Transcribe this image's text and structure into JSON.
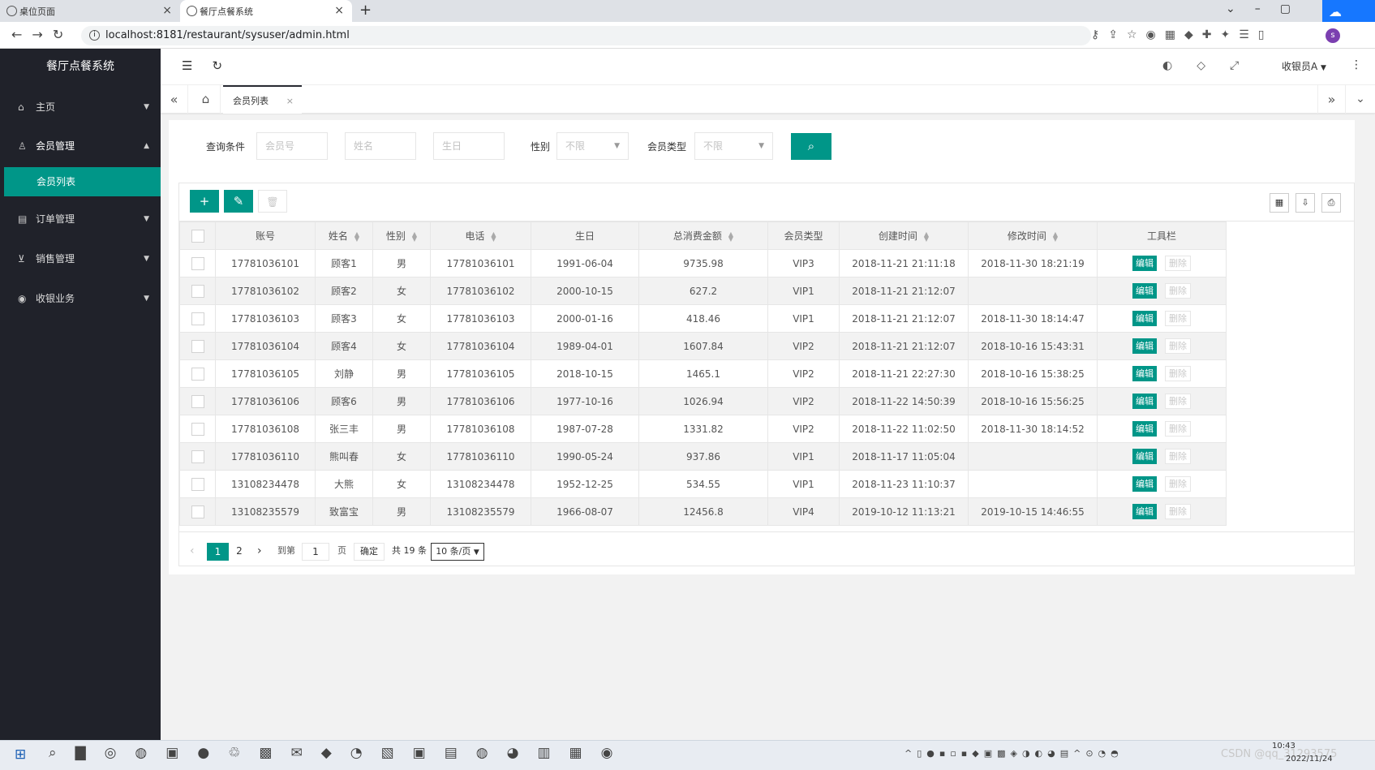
{
  "browser": {
    "tabs": [
      {
        "title": "桌位页面"
      },
      {
        "title": "餐厅点餐系统"
      }
    ],
    "url": "localhost:8181/restaurant/sysuser/admin.html",
    "profile_initial": "s"
  },
  "app": {
    "title": "餐厅点餐系统",
    "user": "收银员A"
  },
  "sidebar": {
    "items": [
      {
        "label": "主页",
        "icon": "home-icon"
      },
      {
        "label": "会员管理",
        "icon": "user-icon"
      },
      {
        "label": "订单管理",
        "icon": "order-icon"
      },
      {
        "label": "销售管理",
        "icon": "cart-icon"
      },
      {
        "label": "收银业务",
        "icon": "cashier-icon"
      }
    ],
    "sub_items": [
      {
        "label": "会员列表"
      }
    ]
  },
  "page_tab": {
    "label": "会员列表"
  },
  "filters": {
    "label": "查询条件",
    "member_no_placeholder": "会员号",
    "name_placeholder": "姓名",
    "birthday_placeholder": "生日",
    "gender_label": "性别",
    "gender_value": "不限",
    "type_label": "会员类型",
    "type_value": "不限"
  },
  "table": {
    "columns": [
      "账号",
      "姓名",
      "性别",
      "电话",
      "生日",
      "总消费金额",
      "会员类型",
      "创建时间",
      "修改时间",
      "工具栏"
    ],
    "edit_label": "编辑",
    "delete_label": "删除",
    "rows": [
      [
        "17781036101",
        "顾客1",
        "男",
        "17781036101",
        "1991-06-04",
        "9735.98",
        "VIP3",
        "2018-11-21 21:11:18",
        "2018-11-30 18:21:19"
      ],
      [
        "17781036102",
        "顾客2",
        "女",
        "17781036102",
        "2000-10-15",
        "627.2",
        "VIP1",
        "2018-11-21 21:12:07",
        ""
      ],
      [
        "17781036103",
        "顾客3",
        "女",
        "17781036103",
        "2000-01-16",
        "418.46",
        "VIP1",
        "2018-11-21 21:12:07",
        "2018-11-30 18:14:47"
      ],
      [
        "17781036104",
        "顾客4",
        "女",
        "17781036104",
        "1989-04-01",
        "1607.84",
        "VIP2",
        "2018-11-21 21:12:07",
        "2018-10-16 15:43:31"
      ],
      [
        "17781036105",
        "刘静",
        "男",
        "17781036105",
        "2018-10-15",
        "1465.1",
        "VIP2",
        "2018-11-21 22:27:30",
        "2018-10-16 15:38:25"
      ],
      [
        "17781036106",
        "顾客6",
        "男",
        "17781036106",
        "1977-10-16",
        "1026.94",
        "VIP2",
        "2018-11-22 14:50:39",
        "2018-10-16 15:56:25"
      ],
      [
        "17781036108",
        "张三丰",
        "男",
        "17781036108",
        "1987-07-28",
        "1331.82",
        "VIP2",
        "2018-11-22 11:02:50",
        "2018-11-30 18:14:52"
      ],
      [
        "17781036110",
        "熊叫春",
        "女",
        "17781036110",
        "1990-05-24",
        "937.86",
        "VIP1",
        "2018-11-17 11:05:04",
        ""
      ],
      [
        "13108234478",
        "大熊",
        "女",
        "13108234478",
        "1952-12-25",
        "534.55",
        "VIP1",
        "2018-11-23 11:10:37",
        ""
      ],
      [
        "13108235579",
        "致富宝",
        "男",
        "13108235579",
        "1966-08-07",
        "12456.8",
        "VIP4",
        "2019-10-12 11:13:21",
        "2019-10-15 14:46:55"
      ]
    ]
  },
  "pager": {
    "pages": [
      "1",
      "2"
    ],
    "goto_label": "到第",
    "goto_value": "1",
    "page_label": "页",
    "ok_label": "确定",
    "total_label": "共 19 条",
    "page_size": "10 条/页"
  },
  "taskbar": {
    "time": "10:43",
    "date": "2022/11/24",
    "watermark": "CSDN @qq_31293575"
  }
}
